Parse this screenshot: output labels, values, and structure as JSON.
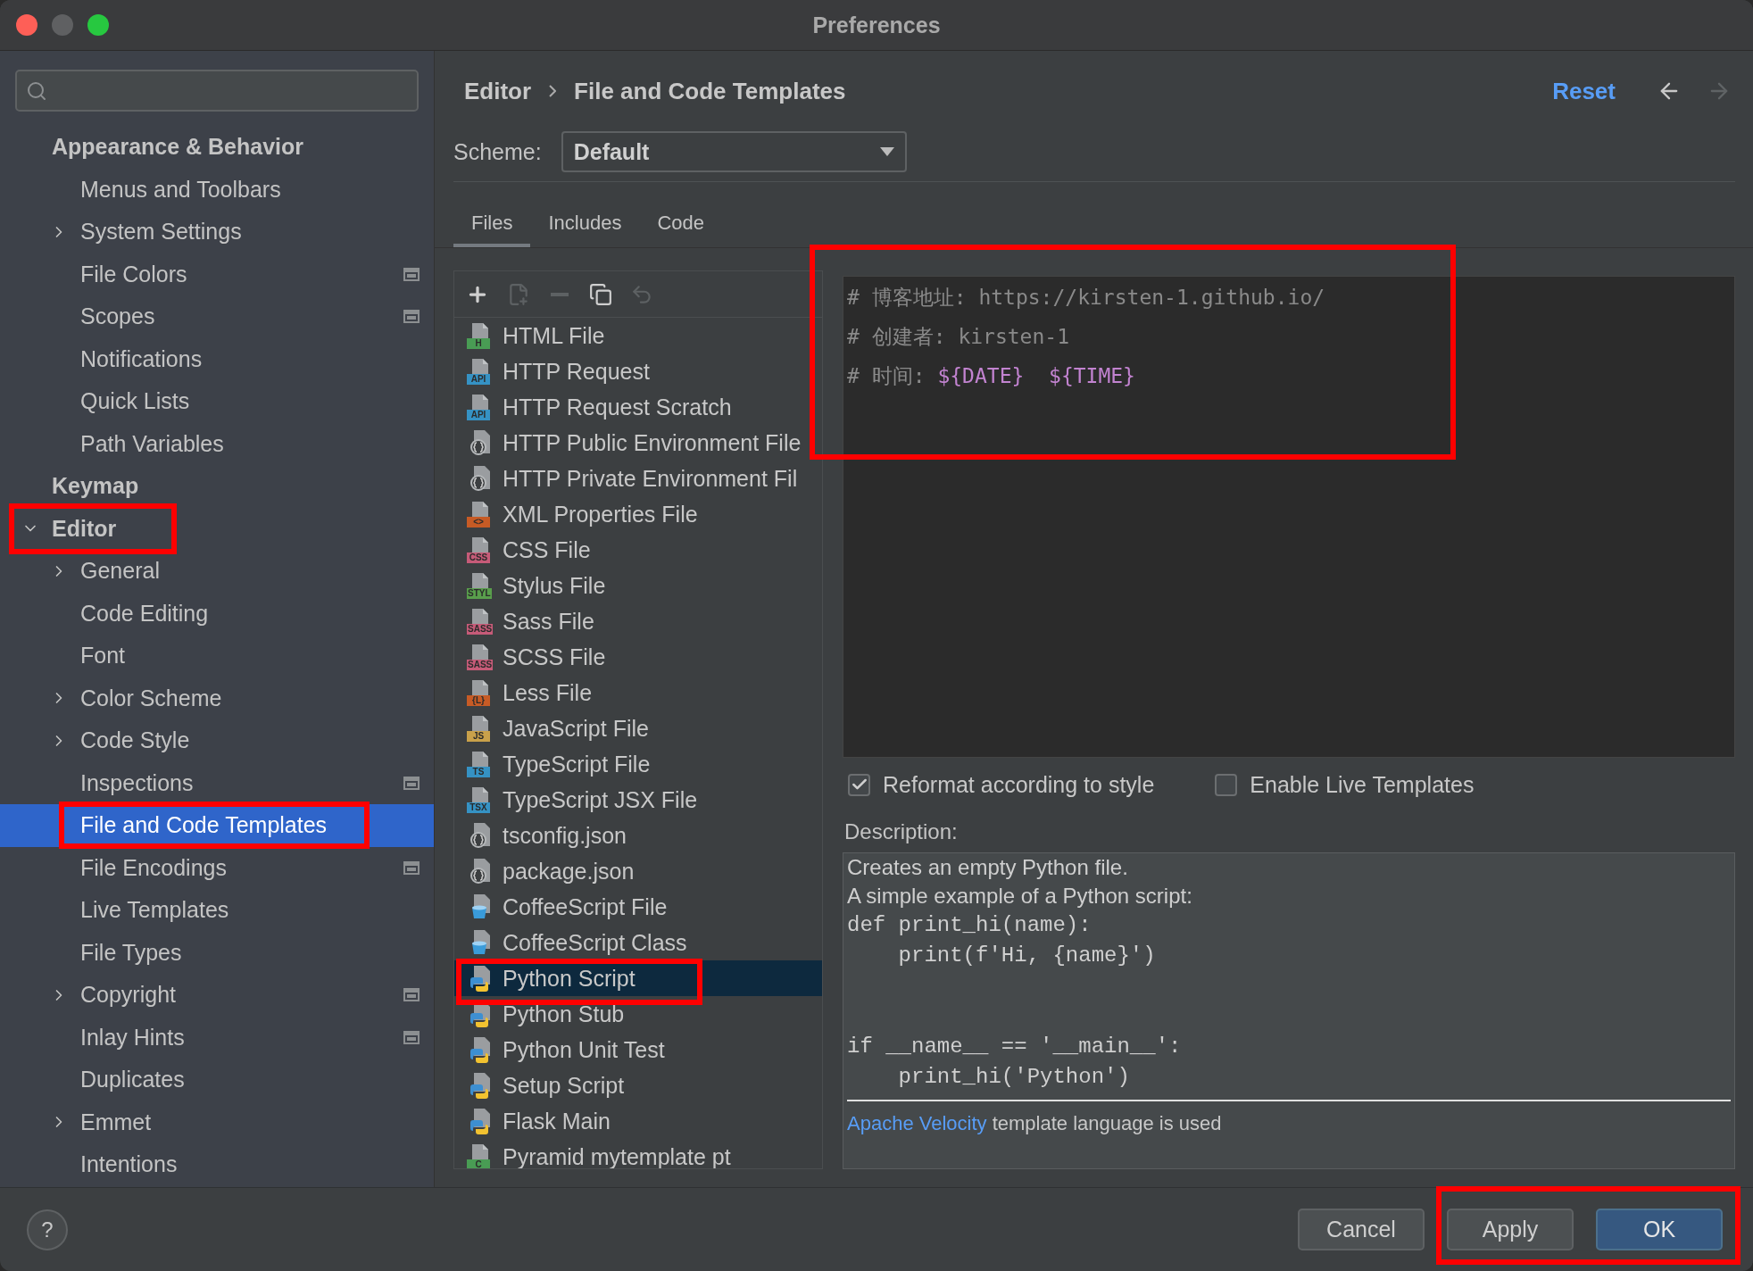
{
  "window": {
    "title": "Preferences"
  },
  "sidebar": {
    "items": [
      {
        "label": "Appearance & Behavior",
        "selected": false,
        "children": [
          {
            "label": "Menus and Toolbars",
            "selected": false
          },
          {
            "label": "System Settings",
            "selected": false,
            "expanded": false
          },
          {
            "label": "File Colors",
            "selected": false,
            "side_icon": true
          },
          {
            "label": "Scopes",
            "selected": false,
            "side_icon": true
          },
          {
            "label": "Notifications",
            "selected": false
          },
          {
            "label": "Quick Lists",
            "selected": false
          },
          {
            "label": "Path Variables",
            "selected": false
          }
        ]
      },
      {
        "label": "Keymap",
        "selected": false
      },
      {
        "label": "Editor",
        "selected": false,
        "expanded": true,
        "annotated": true,
        "children": [
          {
            "label": "General",
            "selected": false,
            "expanded": false
          },
          {
            "label": "Code Editing",
            "selected": false
          },
          {
            "label": "Font",
            "selected": false
          },
          {
            "label": "Color Scheme",
            "selected": false,
            "expanded": false
          },
          {
            "label": "Code Style",
            "selected": false,
            "expanded": false
          },
          {
            "label": "Inspections",
            "selected": false,
            "side_icon": true
          },
          {
            "label": "File and Code Templates",
            "selected": true,
            "annotated": true
          },
          {
            "label": "File Encodings",
            "selected": false,
            "side_icon": true
          },
          {
            "label": "Live Templates",
            "selected": false
          },
          {
            "label": "File Types",
            "selected": false
          },
          {
            "label": "Copyright",
            "selected": false,
            "expanded": false,
            "side_icon": true
          },
          {
            "label": "Inlay Hints",
            "selected": false,
            "side_icon": true
          },
          {
            "label": "Duplicates",
            "selected": false
          },
          {
            "label": "Emmet",
            "selected": false,
            "expanded": false
          },
          {
            "label": "Intentions",
            "selected": false
          }
        ]
      }
    ]
  },
  "header": {
    "breadcrumb": [
      "Editor",
      "File and Code Templates"
    ],
    "reset": "Reset",
    "nav": [
      {
        "kind": "back",
        "disabled": false
      },
      {
        "kind": "forward",
        "disabled": true
      }
    ]
  },
  "scheme": {
    "label": "Scheme:",
    "value": "Default"
  },
  "tabs": [
    {
      "label": "Files",
      "selected": true
    },
    {
      "label": "Includes",
      "selected": false
    },
    {
      "label": "Code",
      "selected": false
    }
  ],
  "templates": {
    "toolbar": [
      {
        "kind": "add",
        "disabled": false
      },
      {
        "kind": "add-child",
        "disabled": true
      },
      {
        "kind": "remove",
        "disabled": true
      },
      {
        "kind": "copy",
        "disabled": false
      },
      {
        "kind": "reset",
        "disabled": true
      }
    ],
    "items": [
      {
        "label": "HTML File",
        "kind": "badge",
        "badge": "H",
        "color": "#499c54",
        "selected": false
      },
      {
        "label": "HTTP Request",
        "kind": "badge",
        "badge": "API",
        "color": "#3592c4",
        "selected": false
      },
      {
        "label": "HTTP Request Scratch",
        "kind": "badge",
        "badge": "API",
        "color": "#3592c4",
        "selected": false
      },
      {
        "label": "HTTP Public Environment File",
        "kind": "json",
        "selected": false
      },
      {
        "label": "HTTP Private Environment Fil",
        "kind": "json",
        "selected": false
      },
      {
        "label": "XML Properties File",
        "kind": "badge",
        "badge": "<>",
        "color": "#c75b25",
        "selected": false
      },
      {
        "label": "CSS File",
        "kind": "badge",
        "badge": "CSS",
        "color": "#c65b78",
        "selected": false
      },
      {
        "label": "Stylus File",
        "kind": "badge",
        "badge": "STYL",
        "color": "#599e4c",
        "selected": false
      },
      {
        "label": "Sass File",
        "kind": "badge",
        "badge": "SASS",
        "color": "#c65b78",
        "selected": false
      },
      {
        "label": "SCSS File",
        "kind": "badge",
        "badge": "SASS",
        "color": "#c65b78",
        "selected": false
      },
      {
        "label": "Less File",
        "kind": "badge",
        "badge": "{L}",
        "color": "#c75b25",
        "selected": false
      },
      {
        "label": "JavaScript File",
        "kind": "badge",
        "badge": "JS",
        "color": "#c9a14a",
        "selected": false
      },
      {
        "label": "TypeScript File",
        "kind": "badge",
        "badge": "TS",
        "color": "#3592c4",
        "selected": false
      },
      {
        "label": "TypeScript JSX File",
        "kind": "badge",
        "badge": "TSX",
        "color": "#3592c4",
        "selected": false
      },
      {
        "label": "tsconfig.json",
        "kind": "json",
        "selected": false
      },
      {
        "label": "package.json",
        "kind": "json",
        "selected": false
      },
      {
        "label": "CoffeeScript File",
        "kind": "coffee",
        "selected": false
      },
      {
        "label": "CoffeeScript Class",
        "kind": "coffee",
        "selected": false
      },
      {
        "label": "Python Script",
        "kind": "python",
        "selected": true,
        "annotated": true
      },
      {
        "label": "Python Stub",
        "kind": "python",
        "selected": false
      },
      {
        "label": "Python Unit Test",
        "kind": "python",
        "selected": false
      },
      {
        "label": "Setup Script",
        "kind": "python",
        "selected": false
      },
      {
        "label": "Flask Main",
        "kind": "python",
        "selected": false
      },
      {
        "label": "Pyramid mytemplate pt",
        "kind": "badge",
        "badge": "C",
        "color": "#499c54",
        "selected": false
      }
    ]
  },
  "editor": {
    "annotated": true,
    "lines": [
      {
        "segments": [
          {
            "kind": "comment",
            "text": "# 博客地址: https://kirsten-1.github.io/"
          }
        ]
      },
      {
        "segments": [
          {
            "kind": "comment",
            "text": "# 创建者: kirsten-1"
          }
        ]
      },
      {
        "segments": [
          {
            "kind": "comment",
            "text": "# 时间: "
          },
          {
            "kind": "variable",
            "text": "${DATE}"
          },
          {
            "kind": "variable",
            "text": "${TIME}"
          }
        ]
      }
    ]
  },
  "options": [
    {
      "label": "Reformat according to style",
      "checked": true
    },
    {
      "label": "Enable Live Templates",
      "checked": false
    }
  ],
  "description": {
    "label": "Description:",
    "text": [
      "Creates an empty Python file.",
      "A simple example of a Python script:"
    ],
    "code": "def print_hi(name):\n    print(f'Hi, {name}')\n\n\nif __name__ == '__main__':\n    print_hi('Python')",
    "footer": {
      "link": "Apache Velocity",
      "text": "template language is used"
    }
  },
  "footer": {
    "help": "?",
    "secondary": [
      {
        "label": "Cancel",
        "kind": "normal"
      }
    ],
    "primary": {
      "annotated": true,
      "items": [
        {
          "label": "Apply",
          "kind": "normal"
        },
        {
          "label": "OK",
          "kind": "default"
        }
      ]
    }
  }
}
